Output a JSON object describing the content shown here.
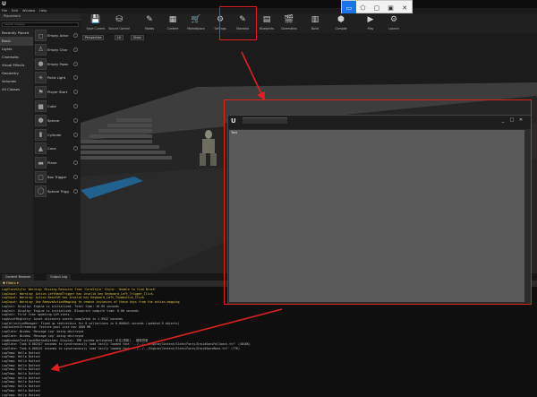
{
  "app": {
    "logo": "U"
  },
  "menu": [
    "File",
    "Edit",
    "Window",
    "Help"
  ],
  "snip_toolbar": [
    {
      "name": "rectangle-snip-icon",
      "glyph": "▭",
      "active": true
    },
    {
      "name": "freeform-snip-icon",
      "glyph": "⬠",
      "active": false
    },
    {
      "name": "window-snip-icon",
      "glyph": "▢",
      "active": false
    },
    {
      "name": "fullscreen-snip-icon",
      "glyph": "▣",
      "active": false
    },
    {
      "name": "close-snip-icon",
      "glyph": "✕",
      "active": false
    }
  ],
  "modes": {
    "label": "Placement"
  },
  "search": {
    "placeholder": "Search Classes"
  },
  "categories": [
    "Recently Placed",
    "Basic",
    "Lights",
    "Cinematic",
    "Visual Effects",
    "Geometry",
    "Volumes",
    "All Classes"
  ],
  "selected_category": "Basic",
  "place_items": [
    {
      "label": "Empty Actor",
      "icon": "cube-icon",
      "glyph": "◻"
    },
    {
      "label": "Empty Char",
      "icon": "character-icon",
      "glyph": "♙"
    },
    {
      "label": "Empty Pawn",
      "icon": "pawn-icon",
      "glyph": "●"
    },
    {
      "label": "Point Light",
      "icon": "point-light-icon",
      "glyph": "☀"
    },
    {
      "label": "Player Start",
      "icon": "player-start-icon",
      "glyph": "⚑"
    },
    {
      "label": "Cube",
      "icon": "cube-icon",
      "glyph": "■"
    },
    {
      "label": "Sphere",
      "icon": "sphere-icon",
      "glyph": "●"
    },
    {
      "label": "Cylinder",
      "icon": "cylinder-icon",
      "glyph": "▮"
    },
    {
      "label": "Cone",
      "icon": "cone-icon",
      "glyph": "▲"
    },
    {
      "label": "Plane",
      "icon": "plane-icon",
      "glyph": "▬"
    },
    {
      "label": "Box Trigger",
      "icon": "box-trigger-icon",
      "glyph": "▢"
    },
    {
      "label": "Sphere Trigg",
      "icon": "sphere-trigger-icon",
      "glyph": "◯"
    }
  ],
  "toolbar": [
    {
      "label": "Save Current",
      "icon": "save-icon",
      "glyph": "💾"
    },
    {
      "label": "Source Control",
      "icon": "source-control-icon",
      "glyph": "⛁"
    },
    {
      "label": "Modes",
      "icon": "modes-icon",
      "glyph": "✎"
    },
    {
      "label": "Content",
      "icon": "content-icon",
      "glyph": "▦"
    },
    {
      "label": "Marketplace",
      "icon": "marketplace-icon",
      "glyph": "🛒"
    },
    {
      "label": "Settings",
      "icon": "settings-icon",
      "glyph": "⚙"
    },
    {
      "label": "Standalo",
      "icon": "standalone-plugin-icon",
      "glyph": "✎"
    },
    {
      "label": "Blueprints",
      "icon": "blueprints-icon",
      "glyph": "▤"
    },
    {
      "label": "Cinematics",
      "icon": "cinematics-icon",
      "glyph": "🎬"
    },
    {
      "label": "Build",
      "icon": "build-icon",
      "glyph": "▥"
    },
    {
      "label": "Compile",
      "icon": "compile-icon",
      "glyph": "⬢"
    },
    {
      "label": "Play",
      "icon": "play-icon",
      "glyph": "▶"
    },
    {
      "label": "Launch",
      "icon": "launch-icon",
      "glyph": "⚙"
    }
  ],
  "viewport": {
    "buttons": [
      "Perspective",
      "Lit",
      "Show"
    ]
  },
  "bottom_tabs": [
    "Content Browser",
    "Output Log"
  ],
  "filters_label": "▼ Filters ▾",
  "log_lines": [
    {
      "text": "LogSlateStyle: Warning: Missing Resource from 'CoreStyle' Style: 'Unable to find Brush'",
      "color": "#e0c040"
    },
    {
      "text": "LogInput: Warning: Action LeftHandTrigger has invalid key Keyboard_Left_Trigger_Click.",
      "color": "#e0c040"
    },
    {
      "text": "LogInput: Warning: Action ResetVR has invalid key Keyboard_Left_Thumbstick_Click.",
      "color": "#e0c040"
    },
    {
      "text": "LogInput: Warning: Use RemoveActionMapping to remove instances of these keys from the action mapping",
      "color": "#e0c040"
    },
    {
      "text": "LogInit: Display: Engine is initialized. Total time: 10.99 seconds",
      "color": "#bdbdbd"
    },
    {
      "text": "LogInit: Display: Engine is initialized. Blueprint compile time: 0.00 seconds",
      "color": "#bdbdbd"
    },
    {
      "text": "LogInit: First time updating LLM stats...",
      "color": "#bdbdbd"
    },
    {
      "text": "LogAssetRegistry: Asset discovery search completed in 1.9942 seconds",
      "color": "#bdbdbd"
    },
    {
      "text": "LogCollectionManager: Fixed up redirectors for 0 collections in 0.000041 seconds (updated 0 objects)",
      "color": "#bdbdbd"
    },
    {
      "text": "LogContentStreaming: Texture pool size now 1000 MB",
      "color": "#bdbdbd"
    },
    {
      "text": "LogSlate: Window 'Message Log' being destroyed",
      "color": "#bdbdbd"
    },
    {
      "text": "LogSlate: Window 'Message Log' being destroyed",
      "color": "#bdbdbd"
    },
    {
      "text": "LogWindowsTextInputMethodSystem: Display: IME system activated: 中文(简体) - 微软拼音",
      "color": "#bdbdbd"
    },
    {
      "text": "LogSlate: Took 0.002417 seconds to synchronously load lazily loaded font '../../../Engine/Content/Slate/Fonts/DroidSansFallback.ttf' (3848K)",
      "color": "#bdbdbd"
    },
    {
      "text": "LogSlate: Took 0.000241 seconds to synchronously load lazily loaded font '../../../Engine/Content/Slate/Fonts/DroidSansMono.ttf' (77K)",
      "color": "#bdbdbd"
    },
    {
      "text": "LogTemp: Hello Button!",
      "color": "#bdbdbd"
    },
    {
      "text": "LogTemp: Hello Button!",
      "color": "#bdbdbd"
    },
    {
      "text": "LogTemp: Hello Button!",
      "color": "#bdbdbd"
    },
    {
      "text": "LogTemp: Hello Button!",
      "color": "#bdbdbd"
    },
    {
      "text": "LogTemp: Hello Button!",
      "color": "#bdbdbd"
    },
    {
      "text": "LogTemp: Hello Button!",
      "color": "#bdbdbd"
    },
    {
      "text": "LogTemp: Hello Button!",
      "color": "#bdbdbd"
    },
    {
      "text": "LogTemp: Hello Button!",
      "color": "#bdbdbd"
    },
    {
      "text": "LogTemp: Hello Button!",
      "color": "#bdbdbd"
    },
    {
      "text": "LogTemp: Hello Button!",
      "color": "#bdbdbd"
    },
    {
      "text": "LogTemp: Hello Button!",
      "color": "#bdbdbd"
    }
  ],
  "new_window": {
    "logo": "U",
    "controls": [
      "_",
      "□",
      "✕"
    ],
    "body_text": "Test"
  },
  "colors": {
    "annotation_red": "#e02020",
    "snip_accent": "#1a73e8"
  }
}
